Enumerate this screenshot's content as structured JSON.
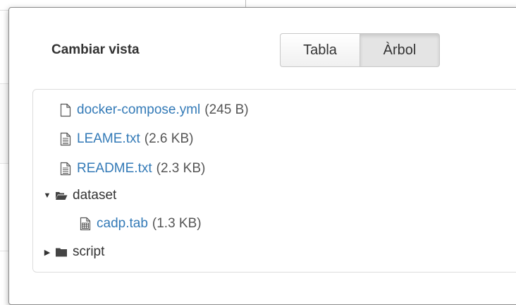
{
  "dialog": {
    "title": "Cambiar vista",
    "toggle": {
      "table_label": "Tabla",
      "tree_label": "Àrbol",
      "active": "tree"
    }
  },
  "tree": [
    {
      "name": "docker-compose.yml",
      "size": "(245 B)",
      "icon": "file-blank-icon",
      "link": true
    },
    {
      "name": "LEAME.txt",
      "size": "(2.6 KB)",
      "icon": "file-text-icon",
      "link": true
    },
    {
      "name": "README.txt",
      "size": "(2.3 KB)",
      "icon": "file-text-icon",
      "link": true
    },
    {
      "name": "dataset",
      "icon": "folder-open-icon",
      "expanded": true,
      "link": false
    },
    {
      "name": "cadp.tab",
      "size": "(1.3 KB)",
      "icon": "file-table-icon",
      "link": true
    },
    {
      "name": "script",
      "icon": "folder-closed-icon",
      "expanded": false,
      "link": false
    }
  ],
  "colors": {
    "link": "#337ab7",
    "text": "#333333",
    "border": "#dcdcdc"
  }
}
